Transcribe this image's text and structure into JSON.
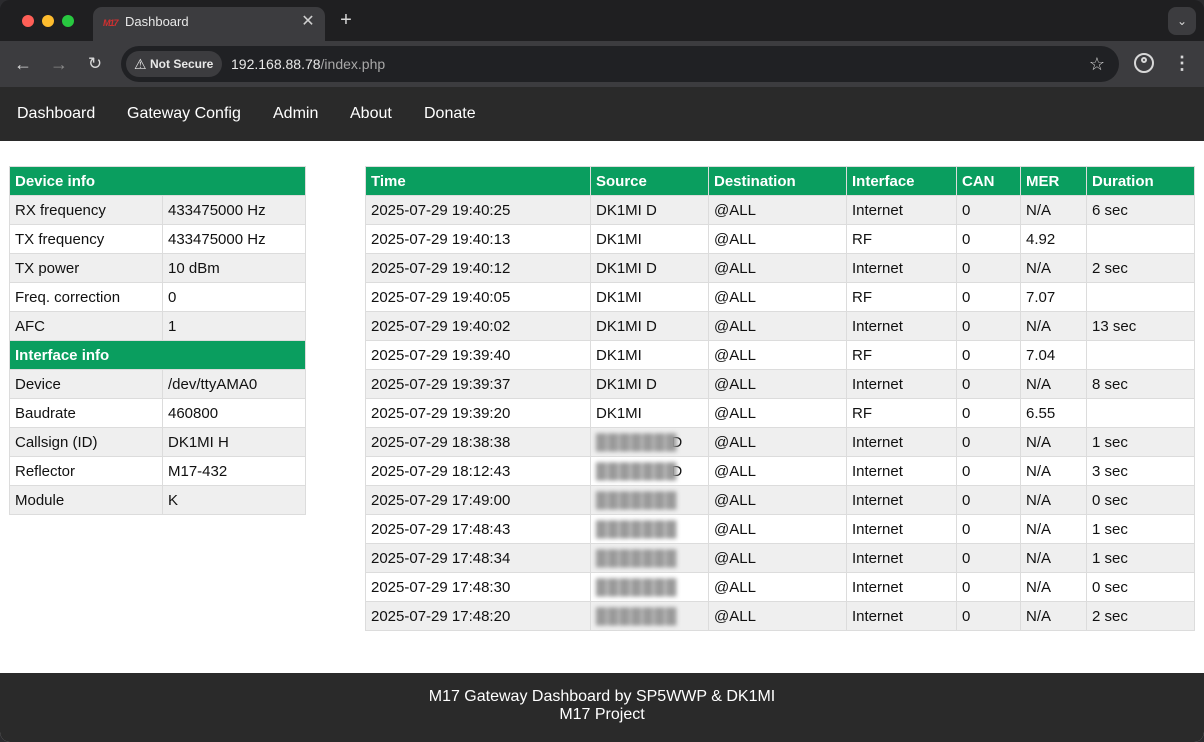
{
  "browser": {
    "tab_title": "Dashboard",
    "tab_favicon": "M17",
    "security_label": "Not Secure",
    "url_host": "192.168.88.78",
    "url_path": "/index.php"
  },
  "nav": {
    "items": [
      "Dashboard",
      "Gateway Config",
      "Admin",
      "About",
      "Donate"
    ]
  },
  "device_info": {
    "title": "Device info",
    "rows": [
      {
        "label": "RX frequency",
        "value": "433475000 Hz"
      },
      {
        "label": "TX frequency",
        "value": "433475000 Hz"
      },
      {
        "label": "TX power",
        "value": "10 dBm"
      },
      {
        "label": "Freq. correction",
        "value": "0"
      },
      {
        "label": "AFC",
        "value": "1"
      }
    ]
  },
  "interface_info": {
    "title": "Interface info",
    "rows": [
      {
        "label": "Device",
        "value": "/dev/ttyAMA0"
      },
      {
        "label": "Baudrate",
        "value": "460800"
      },
      {
        "label": "Callsign (ID)",
        "value": "DK1MI H"
      },
      {
        "label": "Reflector",
        "value": "M17-432"
      },
      {
        "label": "Module",
        "value": "K"
      }
    ]
  },
  "log": {
    "headers": [
      "Time",
      "Source",
      "Destination",
      "Interface",
      "CAN",
      "MER",
      "Duration"
    ],
    "rows": [
      [
        "2025-07-29 19:40:25",
        "DK1MI D",
        "@ALL",
        "Internet",
        "0",
        "N/A",
        "6 sec"
      ],
      [
        "2025-07-29 19:40:13",
        "DK1MI",
        "@ALL",
        "RF",
        "0",
        "4.92",
        ""
      ],
      [
        "2025-07-29 19:40:12",
        "DK1MI D",
        "@ALL",
        "Internet",
        "0",
        "N/A",
        "2 sec"
      ],
      [
        "2025-07-29 19:40:05",
        "DK1MI",
        "@ALL",
        "RF",
        "0",
        "7.07",
        ""
      ],
      [
        "2025-07-29 19:40:02",
        "DK1MI D",
        "@ALL",
        "Internet",
        "0",
        "N/A",
        "13 sec"
      ],
      [
        "2025-07-29 19:39:40",
        "DK1MI",
        "@ALL",
        "RF",
        "0",
        "7.04",
        ""
      ],
      [
        "2025-07-29 19:39:37",
        "DK1MI D",
        "@ALL",
        "Internet",
        "0",
        "N/A",
        "8 sec"
      ],
      [
        "2025-07-29 19:39:20",
        "DK1MI",
        "@ALL",
        "RF",
        "0",
        "6.55",
        ""
      ],
      [
        "2025-07-29 18:38:38",
        "",
        "@ALL",
        "Internet",
        "0",
        "N/A",
        "1 sec"
      ],
      [
        "2025-07-29 18:12:43",
        "",
        "@ALL",
        "Internet",
        "0",
        "N/A",
        "3 sec"
      ],
      [
        "2025-07-29 17:49:00",
        "",
        "@ALL",
        "Internet",
        "0",
        "N/A",
        "0 sec"
      ],
      [
        "2025-07-29 17:48:43",
        "",
        "@ALL",
        "Internet",
        "0",
        "N/A",
        "1 sec"
      ],
      [
        "2025-07-29 17:48:34",
        "",
        "@ALL",
        "Internet",
        "0",
        "N/A",
        "1 sec"
      ],
      [
        "2025-07-29 17:48:30",
        "",
        "@ALL",
        "Internet",
        "0",
        "N/A",
        "0 sec"
      ],
      [
        "2025-07-29 17:48:20",
        "",
        "@ALL",
        "Internet",
        "0",
        "N/A",
        "2 sec"
      ]
    ],
    "redacted_sources": [
      false,
      false,
      false,
      false,
      false,
      false,
      false,
      false,
      true,
      true,
      true,
      true,
      true,
      true,
      true
    ],
    "redacted_suffix": [
      "",
      "",
      "",
      "",
      "",
      "",
      "",
      "",
      "D",
      "D",
      "",
      "",
      "",
      "",
      ""
    ]
  },
  "footer": {
    "line1": "M17 Gateway Dashboard by SP5WWP & DK1MI",
    "line2": "M17 Project"
  },
  "colors": {
    "header_green": "#0a9e5f",
    "nav_bg": "#2a2a2a"
  }
}
